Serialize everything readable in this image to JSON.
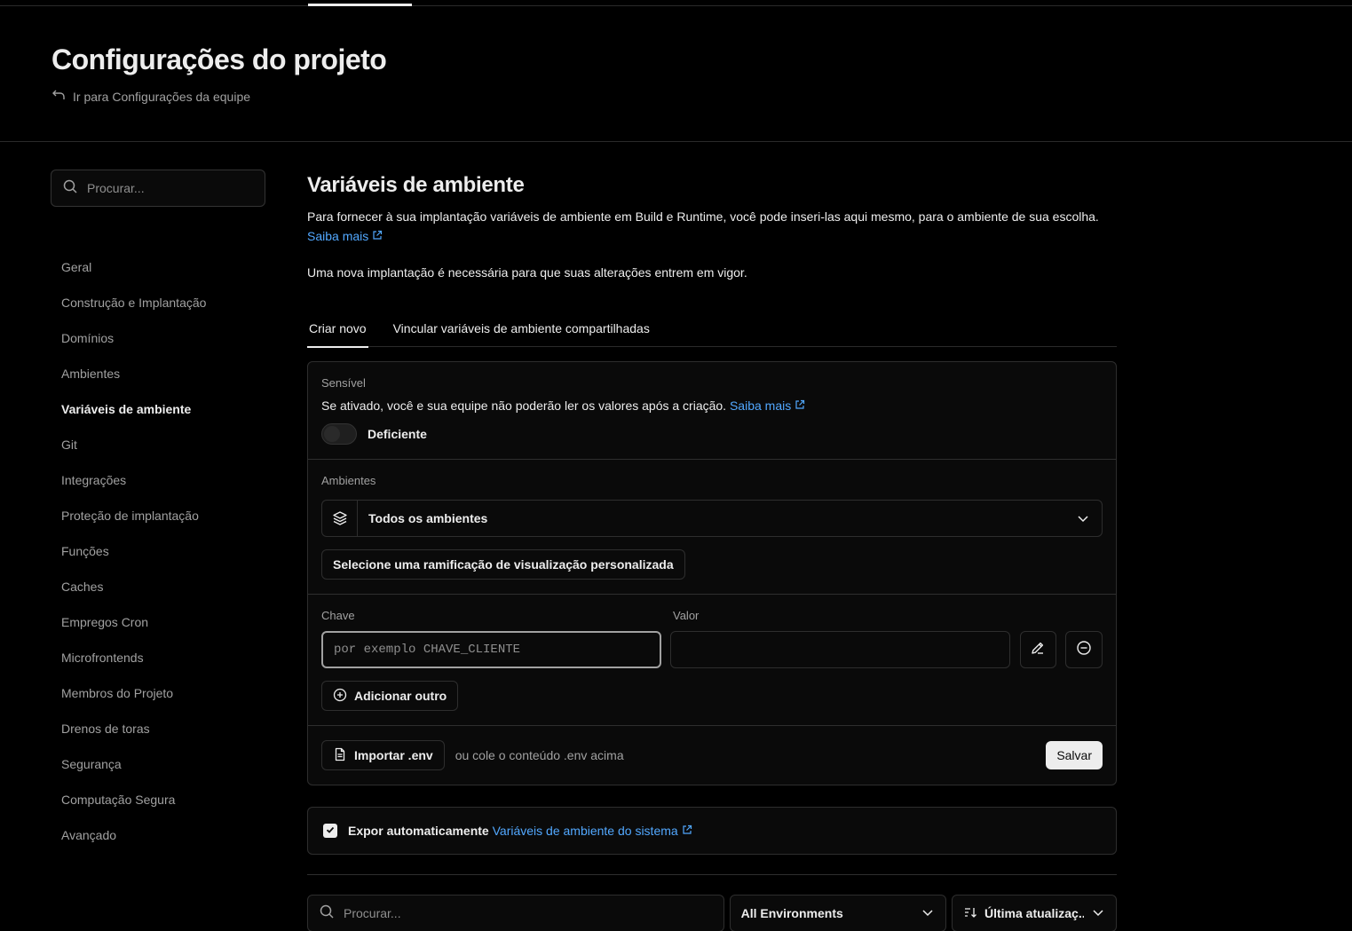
{
  "header": {
    "title": "Configurações do projeto",
    "back_link": "Ir para Configurações da equipe"
  },
  "sidebar": {
    "search_placeholder": "Procurar...",
    "items": [
      {
        "label": "Geral"
      },
      {
        "label": "Construção e Implantação"
      },
      {
        "label": "Domínios"
      },
      {
        "label": "Ambientes"
      },
      {
        "label": "Variáveis de ambiente",
        "active": true
      },
      {
        "label": "Git"
      },
      {
        "label": "Integrações"
      },
      {
        "label": "Proteção de implantação"
      },
      {
        "label": "Funções"
      },
      {
        "label": "Caches"
      },
      {
        "label": "Empregos Cron"
      },
      {
        "label": "Microfrontends"
      },
      {
        "label": "Membros do Projeto"
      },
      {
        "label": "Drenos de toras"
      },
      {
        "label": "Segurança"
      },
      {
        "label": "Computação Segura"
      },
      {
        "label": "Avançado"
      }
    ]
  },
  "main": {
    "title": "Variáveis de ambiente",
    "description": "Para fornecer à sua implantação variáveis de ambiente em Build e Runtime, você pode inseri-las aqui mesmo, para o ambiente de sua escolha.",
    "learn_more": "Saiba mais",
    "note": "Uma nova implantação é necessária para que suas alterações entrem em vigor.",
    "tabs": [
      {
        "label": "Criar novo",
        "active": true
      },
      {
        "label": "Vincular variáveis de ambiente compartilhadas"
      }
    ]
  },
  "form": {
    "sensitive": {
      "label": "Sensível",
      "text": "Se ativado, você e sua equipe não poderão ler os valores após a criação.",
      "learn_more": "Saiba mais",
      "toggle_label": "Deficiente",
      "enabled": false
    },
    "environments": {
      "label": "Ambientes",
      "selected": "Todos os ambientes",
      "branch_button": "Selecione uma ramificação de visualização personalizada"
    },
    "kv": {
      "key_label": "Chave",
      "value_label": "Valor",
      "key_placeholder": "por exemplo CHAVE_CLIENTE",
      "value": "",
      "add_button": "Adicionar outro"
    },
    "footer": {
      "import_button": "Importar .env",
      "hint": "ou cole o conteúdo .env acima",
      "save_button": "Salvar"
    }
  },
  "expose": {
    "checked": true,
    "label": "Expor automaticamente",
    "link": "Variáveis de ambiente do sistema"
  },
  "filters": {
    "search_placeholder": "Procurar...",
    "environment": "All Environments",
    "sort": "Última atualizaç..."
  },
  "colors": {
    "background": "#000000",
    "surface": "#0a0a0a",
    "border": "#2e2e2e",
    "text": "#ededed",
    "muted": "#a1a1a1",
    "link": "#52a8ff"
  }
}
